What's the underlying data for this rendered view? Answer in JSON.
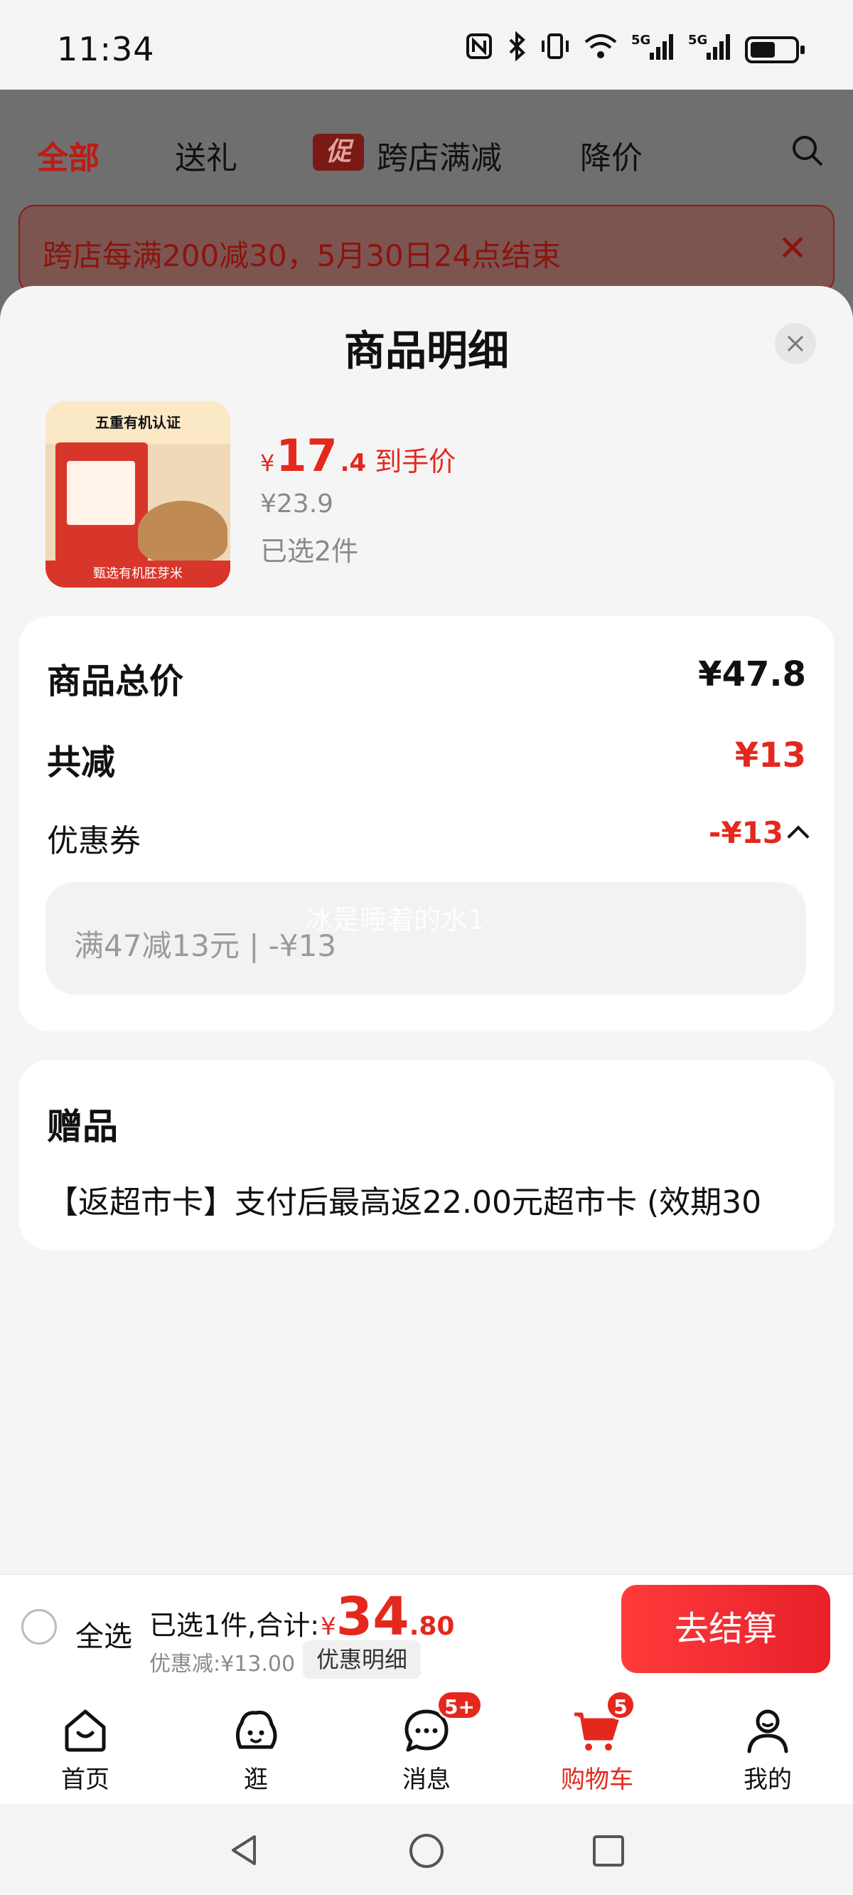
{
  "status_bar": {
    "time": "11:34",
    "icons": [
      "nfc-icon",
      "bluetooth-icon",
      "vibrate-icon",
      "wifi-icon",
      "5g-signal-icon",
      "5g-signal-icon",
      "battery-icon"
    ],
    "net1": "5G",
    "net2": "5G"
  },
  "background_page": {
    "tabs": [
      "全部",
      "送礼",
      "跨店满减",
      "降价"
    ],
    "promo_badge": "促",
    "banner_text": "跨店每满200减30，5月30日24点结束"
  },
  "sheet": {
    "title": "商品明细",
    "product": {
      "image_top_text": "五重有机认证",
      "image_bottom_text": "甄选有机胚芽米",
      "price_currency": "¥",
      "price_int": "17",
      "price_dec": ".4",
      "price_tag": "到手价",
      "original_price": "¥23.9",
      "selected_count": "已选2件"
    },
    "summary": {
      "total_label": "商品总价",
      "total_value": "¥47.8",
      "reduce_label": "共减",
      "reduce_value": "¥13",
      "coupon_label": "优惠券",
      "coupon_value": "-¥13",
      "coupon_detail": "满47减13元 | -¥13",
      "watermark": "冰是睡着的水1"
    },
    "gift": {
      "title": "赠品",
      "text": "【返超市卡】支付后最高返22.00元超市卡 (效期30"
    }
  },
  "checkout": {
    "select_all": "全选",
    "sum_label": "已选1件,合计:",
    "sum_currency": "¥",
    "sum_int": "34",
    "sum_dec": ".80",
    "discount": "优惠减:¥13.00",
    "detail_button": "优惠明细",
    "checkout_button": "去结算"
  },
  "tabbar": {
    "items": [
      {
        "label": "首页",
        "icon": "home-icon"
      },
      {
        "label": "逛",
        "icon": "browse-icon"
      },
      {
        "label": "消息",
        "icon": "message-icon",
        "badge": "5+"
      },
      {
        "label": "购物车",
        "icon": "cart-icon",
        "badge": "5"
      },
      {
        "label": "我的",
        "icon": "profile-icon"
      }
    ]
  },
  "colors": {
    "accent": "#e4281e",
    "banner_text": "#8c140e",
    "overlay": "#6f6f6f"
  }
}
